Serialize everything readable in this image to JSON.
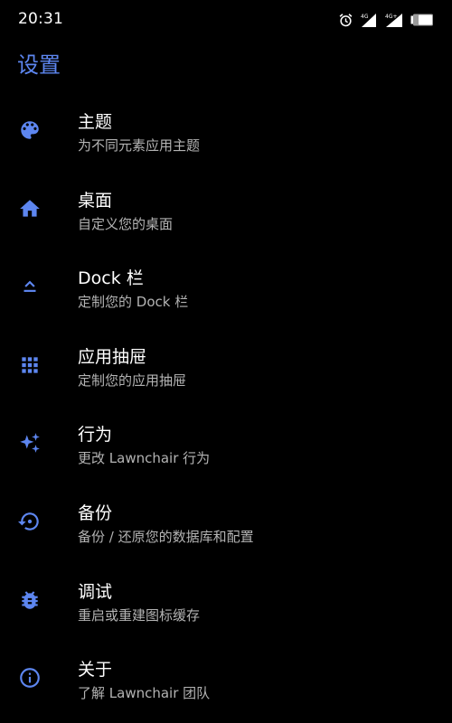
{
  "status_bar": {
    "time": "20:31",
    "alarm_icon": "alarm-clock-icon",
    "signal_1_label": "4G",
    "signal_2_label": "4G+",
    "battery_icon": "battery-icon"
  },
  "header": {
    "title": "设置"
  },
  "colors": {
    "accent": "#5d86f0",
    "background": "#000000",
    "title_text": "#ffffff",
    "subtitle_text": "#b3b3b3"
  },
  "settings": [
    {
      "icon": "palette-icon",
      "title": "主题",
      "subtitle": "为不同元素应用主题"
    },
    {
      "icon": "home-icon",
      "title": "桌面",
      "subtitle": "自定义您的桌面"
    },
    {
      "icon": "dock-icon",
      "title": "Dock 栏",
      "subtitle": "定制您的 Dock 栏"
    },
    {
      "icon": "app-drawer-icon",
      "title": "应用抽屉",
      "subtitle": "定制您的应用抽屉"
    },
    {
      "icon": "sparkle-icon",
      "title": "行为",
      "subtitle": "更改 Lawnchair 行为"
    },
    {
      "icon": "backup-restore-icon",
      "title": "备份",
      "subtitle": "备份 / 还原您的数据库和配置"
    },
    {
      "icon": "bug-icon",
      "title": "调试",
      "subtitle": "重启或重建图标缓存"
    },
    {
      "icon": "info-icon",
      "title": "关于",
      "subtitle": "了解 Lawnchair 团队"
    }
  ]
}
